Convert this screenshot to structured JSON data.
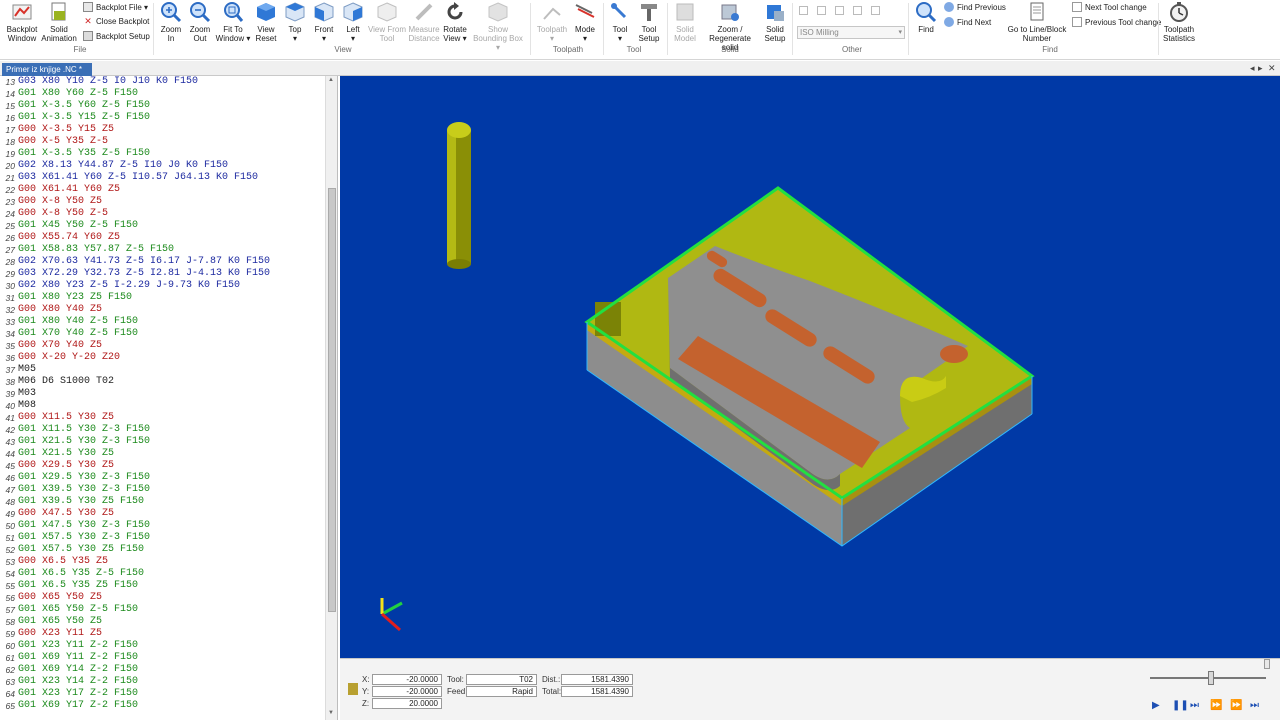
{
  "ribbon": {
    "buttons": {
      "backplot_window": "Backplot\nWindow",
      "solid_animation": "Solid\nAnimation",
      "backplot_file": "Backplot File ▾",
      "close_backplot": "Close Backplot",
      "backplot_setup": "Backplot Setup",
      "zoom_in": "Zoom\nIn",
      "zoom_out": "Zoom\nOut",
      "fit_to_window": "Fit To\nWindow ▾",
      "view_reset": "View\nReset",
      "top": "Top\n▾",
      "front": "Front\n▾",
      "left": "Left\n▾",
      "view_from_tool": "View From\nTool",
      "measure_distance": "Measure\nDistance",
      "rotate_view": "Rotate\nView ▾",
      "show_bounding_box": "Show\nBounding Box ▾",
      "toolpath": "Toolpath\n▾",
      "mode": "Mode\n▾",
      "tool": "Tool\n▾",
      "tool_setup": "Tool\nSetup",
      "solid_model": "Solid\nModel",
      "zoom_regenerate": "Zoom /\nRegenerate solid",
      "solid_setup": "Solid\nSetup",
      "find": "Find",
      "find_previous": "Find Previous",
      "find_next": "Find Next",
      "goto_line": "Go to Line/Block\nNumber",
      "next_tool_change": "Next Tool change",
      "previous_tool_change": "Previous Tool change",
      "toolpath_statistics": "Toolpath\nStatistics"
    },
    "groups": {
      "file": "File",
      "view": "View",
      "toolpath": "Toolpath",
      "tool": "Tool",
      "solid": "Solid",
      "other": "Other",
      "find": "Find"
    },
    "machine_combo": "ISO Milling"
  },
  "document": {
    "tab_label": "Primer iz knjige .NC *"
  },
  "editor": {
    "lines": [
      {
        "n": "13",
        "t": "G03 X80 Y10 Z-5 I0 J10 K0 F150",
        "c": "g02"
      },
      {
        "n": "14",
        "t": "G01 X80 Y60 Z-5 F150",
        "c": "g01"
      },
      {
        "n": "15",
        "t": "G01 X-3.5 Y60 Z-5 F150",
        "c": "g01"
      },
      {
        "n": "16",
        "t": "G01 X-3.5 Y15 Z-5 F150",
        "c": "g01"
      },
      {
        "n": "17",
        "t": "G00 X-3.5 Y15 Z5",
        "c": "g00"
      },
      {
        "n": "18",
        "t": "G00 X-5 Y35 Z-5",
        "c": "g00"
      },
      {
        "n": "19",
        "t": "G01 X-3.5 Y35 Z-5 F150",
        "c": "g01"
      },
      {
        "n": "20",
        "t": "G02 X8.13 Y44.87 Z-5 I10 J0 K0 F150",
        "c": "g02"
      },
      {
        "n": "21",
        "t": "G03 X61.41 Y60 Z-5 I10.57 J64.13 K0 F150",
        "c": "g02"
      },
      {
        "n": "22",
        "t": "G00 X61.41 Y60 Z5",
        "c": "g00"
      },
      {
        "n": "23",
        "t": "G00 X-8 Y50 Z5",
        "c": "g00"
      },
      {
        "n": "24",
        "t": "G00 X-8 Y50 Z-5",
        "c": "g00"
      },
      {
        "n": "25",
        "t": "G01 X45 Y50 Z-5 F150",
        "c": "g01"
      },
      {
        "n": "26",
        "t": "G00 X55.74 Y60 Z5",
        "c": "g00"
      },
      {
        "n": "27",
        "t": "G01 X58.83 Y57.87 Z-5 F150",
        "c": "g01"
      },
      {
        "n": "28",
        "t": "G02 X70.63 Y41.73 Z-5 I6.17 J-7.87 K0 F150",
        "c": "g02"
      },
      {
        "n": "29",
        "t": "G03 X72.29 Y32.73 Z-5 I2.81 J-4.13 K0 F150",
        "c": "g02"
      },
      {
        "n": "30",
        "t": "G02 X80 Y23 Z-5 I-2.29 J-9.73 K0 F150",
        "c": "g02"
      },
      {
        "n": "31",
        "t": "G01 X80 Y23 Z5 F150",
        "c": "g01"
      },
      {
        "n": "32",
        "t": "G00 X80 Y40 Z5",
        "c": "g00"
      },
      {
        "n": "33",
        "t": "G01 X80 Y40 Z-5 F150",
        "c": "g01"
      },
      {
        "n": "34",
        "t": "G01 X70 Y40 Z-5 F150",
        "c": "g01"
      },
      {
        "n": "35",
        "t": "G00 X70 Y40 Z5",
        "c": "g00"
      },
      {
        "n": "36",
        "t": "G00 X-20 Y-20 Z20",
        "c": "g00"
      },
      {
        "n": "37",
        "t": "M05",
        "c": "m"
      },
      {
        "n": "38",
        "t": "M06 D6 S1000 T02",
        "c": "m"
      },
      {
        "n": "39",
        "t": "M03",
        "c": "m"
      },
      {
        "n": "40",
        "t": "M08",
        "c": "m"
      },
      {
        "n": "41",
        "t": "G00 X11.5 Y30 Z5",
        "c": "g00"
      },
      {
        "n": "42",
        "t": "G01 X11.5 Y30 Z-3 F150",
        "c": "g01"
      },
      {
        "n": "43",
        "t": "G01 X21.5 Y30 Z-3 F150",
        "c": "g01"
      },
      {
        "n": "44",
        "t": "G01 X21.5 Y30 Z5",
        "c": "g01"
      },
      {
        "n": "45",
        "t": "G00 X29.5 Y30 Z5",
        "c": "g00"
      },
      {
        "n": "46",
        "t": "G01 X29.5 Y30 Z-3 F150",
        "c": "g01"
      },
      {
        "n": "47",
        "t": "G01 X39.5 Y30 Z-3 F150",
        "c": "g01"
      },
      {
        "n": "48",
        "t": "G01 X39.5 Y30 Z5 F150",
        "c": "g01"
      },
      {
        "n": "49",
        "t": "G00 X47.5 Y30 Z5",
        "c": "g00"
      },
      {
        "n": "50",
        "t": "G01 X47.5 Y30 Z-3 F150",
        "c": "g01"
      },
      {
        "n": "51",
        "t": "G01 X57.5 Y30 Z-3 F150",
        "c": "g01"
      },
      {
        "n": "52",
        "t": "G01 X57.5 Y30 Z5 F150",
        "c": "g01"
      },
      {
        "n": "53",
        "t": "G00 X6.5 Y35 Z5",
        "c": "g00"
      },
      {
        "n": "54",
        "t": "G01 X6.5 Y35 Z-5 F150",
        "c": "g01"
      },
      {
        "n": "55",
        "t": "G01 X6.5 Y35 Z5 F150",
        "c": "g01"
      },
      {
        "n": "56",
        "t": "G00 X65 Y50 Z5",
        "c": "g00"
      },
      {
        "n": "57",
        "t": "G01 X65 Y50 Z-5 F150",
        "c": "g01"
      },
      {
        "n": "58",
        "t": "G01 X65 Y50 Z5",
        "c": "g01"
      },
      {
        "n": "59",
        "t": "G00 X23 Y11 Z5",
        "c": "g00"
      },
      {
        "n": "60",
        "t": "G01 X23 Y11 Z-2 F150",
        "c": "g01"
      },
      {
        "n": "61",
        "t": "G01 X69 Y11 Z-2 F150",
        "c": "g01"
      },
      {
        "n": "62",
        "t": "G01 X69 Y14 Z-2 F150",
        "c": "g01"
      },
      {
        "n": "63",
        "t": "G01 X23 Y14 Z-2 F150",
        "c": "g01"
      },
      {
        "n": "64",
        "t": "G01 X23 Y17 Z-2 F150",
        "c": "g01"
      },
      {
        "n": "65",
        "t": "G01 X69 Y17 Z-2 F150",
        "c": "g01"
      }
    ]
  },
  "status": {
    "x_label": "X:",
    "x_value": "-20.0000",
    "y_label": "Y:",
    "y_value": "-20.0000",
    "z_label": "Z:",
    "z_value": "20.0000",
    "tool_label": "Tool:",
    "tool_value": "T02",
    "feed_label": "Feed:",
    "feed_value": "Rapid",
    "dist_label": "Dist.:",
    "dist_value": "1581.4390",
    "total_label": "Total:",
    "total_value": "1581.4390"
  },
  "colors": {
    "viewport_bg": "#0039a6",
    "g00": "#b01818",
    "g01": "#1c8a1c",
    "g02": "#1d2aa0",
    "stock_top": "#b8c010",
    "bounding_box": "#22e040",
    "pocket": "#c4622e"
  }
}
